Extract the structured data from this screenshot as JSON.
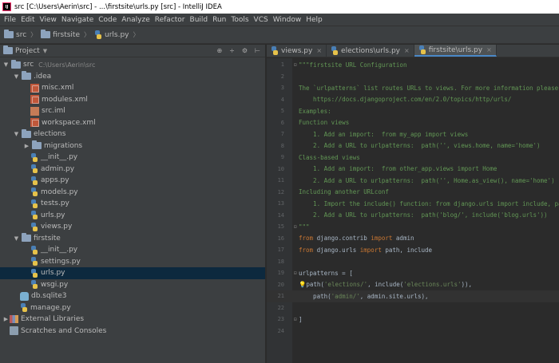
{
  "window": {
    "app_icon": "IJ",
    "title": "src [C:\\Users\\Aerin\\src] - ...\\firstsite\\urls.py [src] - IntelliJ IDEA"
  },
  "menu": [
    "File",
    "Edit",
    "View",
    "Navigate",
    "Code",
    "Analyze",
    "Refactor",
    "Build",
    "Run",
    "Tools",
    "VCS",
    "Window",
    "Help"
  ],
  "breadcrumb": [
    "src",
    "firstsite",
    "urls.py"
  ],
  "project_panel": {
    "title": "Project",
    "tools": [
      "⊕",
      "÷",
      "⚙",
      "⊢"
    ]
  },
  "tree": [
    {
      "depth": 0,
      "arrow": "▼",
      "icon": "folder",
      "label": "src",
      "path": "C:\\Users\\Aerin\\src"
    },
    {
      "depth": 1,
      "arrow": "▼",
      "icon": "folder",
      "label": ".idea"
    },
    {
      "depth": 2,
      "arrow": "",
      "icon": "xml",
      "label": "misc.xml"
    },
    {
      "depth": 2,
      "arrow": "",
      "icon": "xml",
      "label": "modules.xml"
    },
    {
      "depth": 2,
      "arrow": "",
      "icon": "iml",
      "label": "src.iml"
    },
    {
      "depth": 2,
      "arrow": "",
      "icon": "xml",
      "label": "workspace.xml"
    },
    {
      "depth": 1,
      "arrow": "▼",
      "icon": "folder",
      "label": "elections"
    },
    {
      "depth": 2,
      "arrow": "▶",
      "icon": "folder",
      "label": "migrations"
    },
    {
      "depth": 2,
      "arrow": "",
      "icon": "py",
      "label": "__init__.py"
    },
    {
      "depth": 2,
      "arrow": "",
      "icon": "py",
      "label": "admin.py"
    },
    {
      "depth": 2,
      "arrow": "",
      "icon": "py",
      "label": "apps.py"
    },
    {
      "depth": 2,
      "arrow": "",
      "icon": "py",
      "label": "models.py"
    },
    {
      "depth": 2,
      "arrow": "",
      "icon": "py",
      "label": "tests.py"
    },
    {
      "depth": 2,
      "arrow": "",
      "icon": "py",
      "label": "urls.py"
    },
    {
      "depth": 2,
      "arrow": "",
      "icon": "py",
      "label": "views.py"
    },
    {
      "depth": 1,
      "arrow": "▼",
      "icon": "folder",
      "label": "firstsite"
    },
    {
      "depth": 2,
      "arrow": "",
      "icon": "py",
      "label": "__init__.py"
    },
    {
      "depth": 2,
      "arrow": "",
      "icon": "py",
      "label": "settings.py"
    },
    {
      "depth": 2,
      "arrow": "",
      "icon": "py",
      "label": "urls.py",
      "selected": true
    },
    {
      "depth": 2,
      "arrow": "",
      "icon": "py",
      "label": "wsgi.py"
    },
    {
      "depth": 1,
      "arrow": "",
      "icon": "db",
      "label": "db.sqlite3"
    },
    {
      "depth": 1,
      "arrow": "",
      "icon": "py",
      "label": "manage.py"
    },
    {
      "depth": 0,
      "arrow": "▶",
      "icon": "lib",
      "label": "External Libraries"
    },
    {
      "depth": 0,
      "arrow": "",
      "icon": "scr",
      "label": "Scratches and Consoles"
    }
  ],
  "tabs": [
    {
      "label": "views.py",
      "active": false
    },
    {
      "label": "elections\\urls.py",
      "active": false
    },
    {
      "label": "firstsite\\urls.py",
      "active": true
    }
  ],
  "code_lines": [
    [
      [
        "doc",
        "\"\"\"firstsite URL Configuration"
      ]
    ],
    [
      [
        "doc",
        ""
      ]
    ],
    [
      [
        "doc",
        "The `urlpatterns` list routes URLs to views. For more information please see:"
      ]
    ],
    [
      [
        "doc",
        "    https://docs.djangoproject.com/en/2.0/topics/http/urls/"
      ]
    ],
    [
      [
        "doc",
        "Examples:"
      ]
    ],
    [
      [
        "doc",
        "Function views"
      ]
    ],
    [
      [
        "doc",
        "    1. Add an import:  from my_app import views"
      ]
    ],
    [
      [
        "doc",
        "    2. Add a URL to urlpatterns:  path('', views.home, name='home')"
      ]
    ],
    [
      [
        "doc",
        "Class-based views"
      ]
    ],
    [
      [
        "doc",
        "    1. Add an import:  from other_app.views import Home"
      ]
    ],
    [
      [
        "doc",
        "    2. Add a URL to urlpatterns:  path('', Home.as_view(), name='home')"
      ]
    ],
    [
      [
        "doc",
        "Including another URLconf"
      ]
    ],
    [
      [
        "doc",
        "    1. Import the include() function: from django.urls import include, path"
      ]
    ],
    [
      [
        "doc",
        "    2. Add a URL to urlpatterns:  path('blog/', include('blog.urls'))"
      ]
    ],
    [
      [
        "doc",
        "\"\"\""
      ]
    ],
    [
      [
        "kw",
        "from "
      ],
      [
        "plain",
        "django.contrib "
      ],
      [
        "kw",
        "import "
      ],
      [
        "plain",
        "admin"
      ]
    ],
    [
      [
        "kw",
        "from "
      ],
      [
        "plain",
        "django.urls "
      ],
      [
        "kw",
        "import "
      ],
      [
        "plain",
        "path, include"
      ]
    ],
    [
      [
        "plain",
        ""
      ]
    ],
    [
      [
        "plain",
        "urlpatterns = ["
      ]
    ],
    [
      [
        "bulb",
        "💡"
      ],
      [
        "plain",
        "path("
      ],
      [
        "str",
        "'elections/'"
      ],
      [
        "plain",
        ", include("
      ],
      [
        "str",
        "'elections.urls'"
      ],
      [
        "plain",
        ")),"
      ]
    ],
    [
      [
        "plain",
        "    path("
      ],
      [
        "str",
        "'admin/'"
      ],
      [
        "plain",
        ", admin.site.urls),"
      ]
    ],
    [
      [
        "plain",
        ""
      ]
    ],
    [
      [
        "plain",
        "]"
      ]
    ],
    [
      [
        "plain",
        ""
      ]
    ]
  ],
  "current_line": 21
}
